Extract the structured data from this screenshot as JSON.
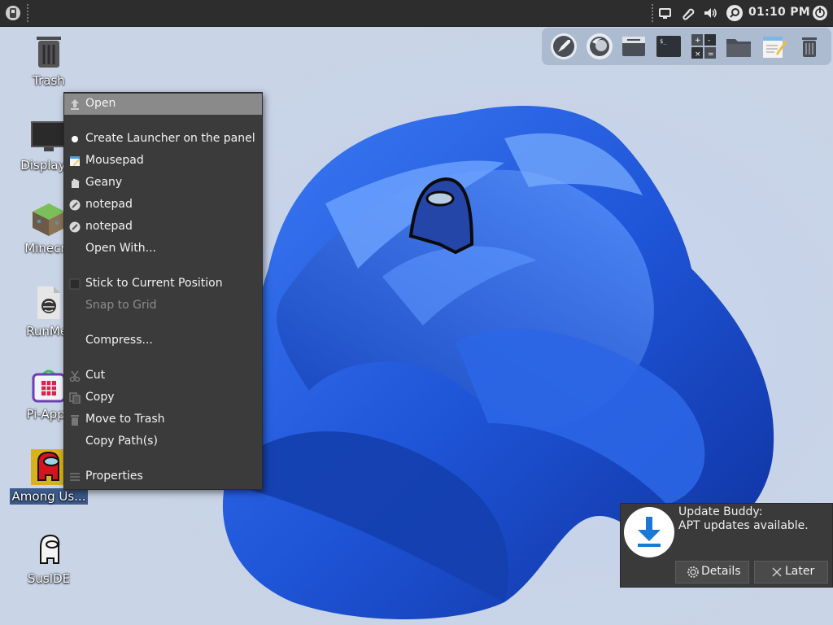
{
  "topbar": {
    "clock": "01:10 PM"
  },
  "dock": {
    "items": [
      "rocket-launcher-icon",
      "firefox-icon",
      "window-manager-icon",
      "terminal-icon",
      "calculator-icon",
      "file-manager-icon",
      "text-editor-icon",
      "trash-icon"
    ]
  },
  "desktop_icons": [
    {
      "label": "Trash",
      "icon": "trash-icon"
    },
    {
      "label": "Display S",
      "icon": "display-icon"
    },
    {
      "label": "Minecra",
      "icon": "minecraft-icon"
    },
    {
      "label": "RunMe.",
      "icon": "script-file-icon"
    },
    {
      "label": "Pi-Apps",
      "icon": "pi-apps-icon"
    },
    {
      "label": "Among Us...",
      "icon": "among-us-icon"
    },
    {
      "label": "SusIDE",
      "icon": "suside-icon"
    }
  ],
  "context_menu": {
    "items": [
      {
        "label": "Open",
        "icon": "open-icon"
      },
      {
        "label": "Create Launcher on the panel",
        "icon": "bullet-icon"
      },
      {
        "label": "Mousepad",
        "icon": "mousepad-icon"
      },
      {
        "label": "Geany",
        "icon": "geany-icon"
      },
      {
        "label": "notepad",
        "icon": "notepad-icon"
      },
      {
        "label": "notepad",
        "icon": "notepad-icon"
      },
      {
        "label": "Open With...",
        "icon": ""
      },
      {
        "label": "Stick to Current Position",
        "icon": "checkbox-icon"
      },
      {
        "label": "Snap to Grid",
        "icon": ""
      },
      {
        "label": "Compress...",
        "icon": ""
      },
      {
        "label": "Cut",
        "icon": "cut-icon"
      },
      {
        "label": "Copy",
        "icon": "copy-icon"
      },
      {
        "label": "Move to Trash",
        "icon": "trash-icon"
      },
      {
        "label": "Copy Path(s)",
        "icon": ""
      },
      {
        "label": "Properties",
        "icon": "properties-icon"
      }
    ]
  },
  "notification": {
    "title": "Update Buddy:",
    "body": "APT updates available.",
    "details_label": "Details",
    "later_label": "Later"
  },
  "colors": {
    "wallpaper": "#cad6ea",
    "bloom": "#1f5fe0",
    "panel": "#2d2d2d",
    "menu": "#3b3b3b",
    "highlight": "#8a8a8a"
  }
}
